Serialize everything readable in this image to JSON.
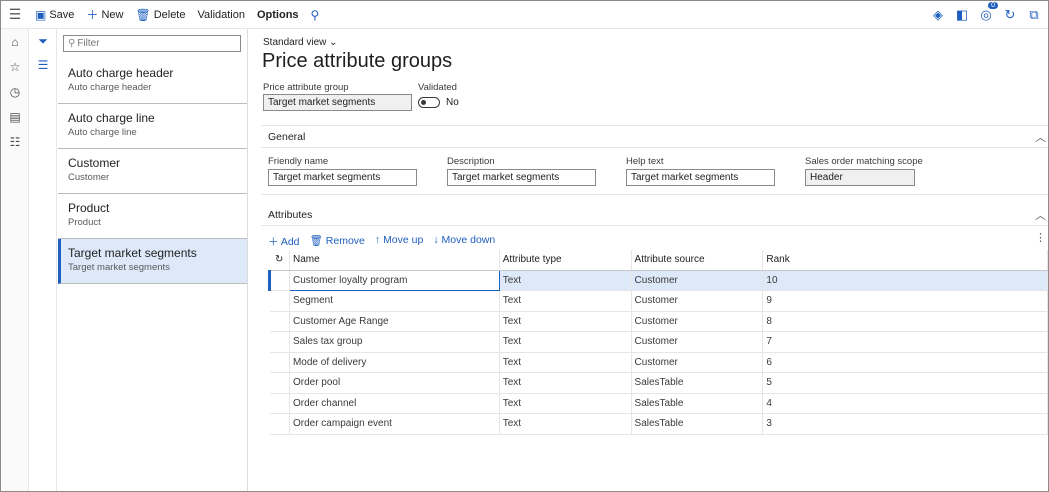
{
  "toolbar": {
    "save": "Save",
    "new": "New",
    "delete": "Delete",
    "validation": "Validation",
    "options": "Options",
    "notification_count": "0"
  },
  "list": {
    "filter_placeholder": "Filter",
    "items": [
      {
        "title": "Auto charge header",
        "subtitle": "Auto charge header"
      },
      {
        "title": "Auto charge line",
        "subtitle": "Auto charge line"
      },
      {
        "title": "Customer",
        "subtitle": "Customer"
      },
      {
        "title": "Product",
        "subtitle": "Product"
      },
      {
        "title": "Target market segments",
        "subtitle": "Target market segments"
      }
    ]
  },
  "page": {
    "view": "Standard view",
    "title": "Price attribute groups",
    "group_label": "Price attribute group",
    "group_value": "Target market segments",
    "validated_label": "Validated",
    "validated_value": "No"
  },
  "general": {
    "heading": "General",
    "friendly_name_label": "Friendly name",
    "friendly_name": "Target market segments",
    "description_label": "Description",
    "description": "Target market segments",
    "help_label": "Help text",
    "help": "Target market segments",
    "scope_label": "Sales order matching scope",
    "scope": "Header"
  },
  "attributes": {
    "heading": "Attributes",
    "add": "Add",
    "remove": "Remove",
    "move_up": "Move up",
    "move_down": "Move down",
    "columns": [
      "Name",
      "Attribute type",
      "Attribute source",
      "Rank"
    ],
    "rows": [
      {
        "name": "Customer loyalty program",
        "type": "Text",
        "source": "Customer",
        "rank": "10"
      },
      {
        "name": "Segment",
        "type": "Text",
        "source": "Customer",
        "rank": "9"
      },
      {
        "name": "Customer Age Range",
        "type": "Text",
        "source": "Customer",
        "rank": "8"
      },
      {
        "name": "Sales tax group",
        "type": "Text",
        "source": "Customer",
        "rank": "7"
      },
      {
        "name": "Mode of delivery",
        "type": "Text",
        "source": "Customer",
        "rank": "6"
      },
      {
        "name": "Order pool",
        "type": "Text",
        "source": "SalesTable",
        "rank": "5"
      },
      {
        "name": "Order channel",
        "type": "Text",
        "source": "SalesTable",
        "rank": "4"
      },
      {
        "name": "Order campaign event",
        "type": "Text",
        "source": "SalesTable",
        "rank": "3"
      }
    ]
  }
}
